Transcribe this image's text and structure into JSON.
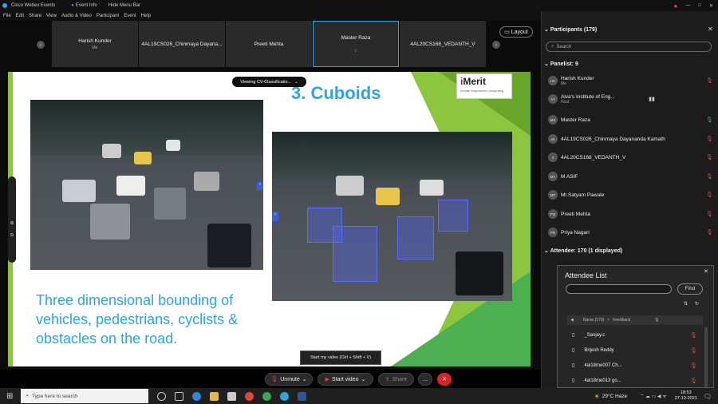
{
  "titlebar": {
    "app": "Cisco Webex Events",
    "event_info": "Event Info",
    "hide_menu": "Hide Menu Bar"
  },
  "menubar": [
    "File",
    "Edit",
    "Share",
    "View",
    "Audio & Video",
    "Participant",
    "Event",
    "Help"
  ],
  "thumbnails": [
    {
      "name": "Harish Kunder",
      "sub": "Me"
    },
    {
      "name": "4AL19CS026_Chinmaya Dayana...",
      "sub": ""
    },
    {
      "name": "Preeti Mehta",
      "sub": ""
    },
    {
      "name": "Master Raza",
      "sub": ""
    },
    {
      "name": "4AL20CS168_VEDANTH_V",
      "sub": ""
    }
  ],
  "layout_label": "Layout",
  "viewing_label": "Viewing CV-Classificatio...",
  "slide": {
    "title": "3. Cuboids",
    "logo_main": "Merit",
    "logo_i": "i",
    "logo_tag": "human-empowered computing",
    "body_text": "Three dimensional bounding of vehicles, pedestrians, cyclists & obstacles on the road."
  },
  "tooltip": "Start my video (Ctrl + Shift + V)",
  "controls": {
    "unmute": "Unmute",
    "start_video": "Start video",
    "share": "Share",
    "more": "…"
  },
  "panel": {
    "title": "Participants (179)",
    "search_placeholder": "Search",
    "panelist_header": "Panelist: 9",
    "panelists": [
      {
        "initials": "HK",
        "name": "Harish Kunder",
        "role": "Me",
        "mic": "muted"
      },
      {
        "initials": "AT",
        "name": "Alva's Institute of Eng...",
        "role": "Host",
        "mic": "active"
      },
      {
        "initials": "MR",
        "name": "Master Raza",
        "role": "",
        "mic": "on"
      },
      {
        "initials": "4K",
        "name": "4AL19CS026_Chinmaya Dayananda Kamath",
        "role": "",
        "mic": "muted"
      },
      {
        "initials": "4",
        "name": "4AL20CS168_VEDANTH_V",
        "role": "",
        "mic": "muted"
      },
      {
        "initials": "MA",
        "name": "M ASIF",
        "role": "",
        "mic": "muted"
      },
      {
        "initials": "MP",
        "name": "Mr.Satyam Pawale",
        "role": "",
        "mic": "muted"
      },
      {
        "initials": "PM",
        "name": "Preeti Mehta",
        "role": "",
        "mic": "muted"
      },
      {
        "initials": "PN",
        "name": "Priya Nagari",
        "role": "",
        "mic": "muted"
      }
    ],
    "attendee_header": "Attendee: 170 (1 displayed)"
  },
  "attendee_list": {
    "title": "Attendee List",
    "find_label": "Find",
    "col_name": "Name (170)",
    "col_feedback": "Feedback",
    "rows": [
      "_Sanjay.c",
      "Brijesh Reddy",
      "4al18me007 Ch...",
      "4al18me013 go..."
    ]
  },
  "taskbar": {
    "search_placeholder": "Type here to search",
    "weather": "29°C Haze",
    "time": "18:53",
    "date": "27-10-2021"
  },
  "colors": {
    "accent_blue": "#2aa7df",
    "mute_red": "#e0443c",
    "end_red": "#d9232b",
    "panel_bg": "#1c1c1c"
  }
}
